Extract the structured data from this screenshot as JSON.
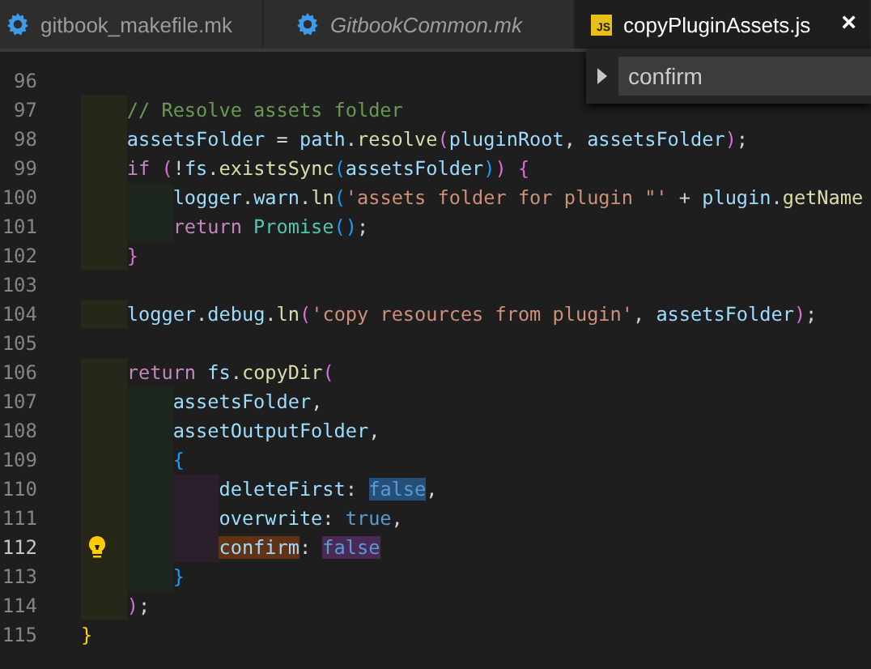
{
  "tabs": [
    {
      "label": "gitbook_makefile.mk",
      "kind": "makefile",
      "italic": false,
      "selected": false,
      "closable": false
    },
    {
      "label": "GitbookCommon.mk",
      "kind": "makefile",
      "italic": true,
      "selected": false,
      "closable": false
    },
    {
      "label": "copyPluginAssets.js",
      "kind": "script",
      "italic": false,
      "selected": true,
      "closable": true
    }
  ],
  "js_badge": "JS",
  "close_glyph": "×",
  "find_widget": {
    "value": "confirm"
  },
  "editor": {
    "lines": [
      {
        "number": "96",
        "current": false
      },
      {
        "number": "97",
        "current": false,
        "tokens": [
          {
            "text": "    // Resolve assets folder",
            "kind": "cmt"
          }
        ]
      },
      {
        "number": "98",
        "current": false,
        "tokens": [
          {
            "text": "    assetsFolder",
            "kind": "var"
          },
          {
            "text": " = ",
            "kind": "punct"
          },
          {
            "text": "path",
            "kind": "var"
          },
          {
            "text": ".",
            "kind": "punct"
          },
          {
            "text": "resolve",
            "kind": "fn"
          },
          {
            "text": "(",
            "kind": "b2"
          },
          {
            "text": "pluginRoot",
            "kind": "var"
          },
          {
            "text": ", ",
            "kind": "punct"
          },
          {
            "text": "assetsFolder",
            "kind": "var"
          },
          {
            "text": ")",
            "kind": "b2"
          },
          {
            "text": ";",
            "kind": "punct"
          }
        ]
      },
      {
        "number": "99",
        "current": false,
        "tokens": [
          {
            "text": "    if ",
            "kind": "kw"
          },
          {
            "text": "(",
            "kind": "b2"
          },
          {
            "text": "!",
            "kind": "punct"
          },
          {
            "text": "fs",
            "kind": "var"
          },
          {
            "text": ".",
            "kind": "punct"
          },
          {
            "text": "existsSync",
            "kind": "fn"
          },
          {
            "text": "(",
            "kind": "b3"
          },
          {
            "text": "assetsFolder",
            "kind": "var"
          },
          {
            "text": ")",
            "kind": "b3"
          },
          {
            "text": ")",
            "kind": "b2"
          },
          {
            "text": " {",
            "kind": "b2"
          }
        ]
      },
      {
        "number": "100",
        "current": false,
        "tokens": [
          {
            "text": "        logger",
            "kind": "var"
          },
          {
            "text": ".",
            "kind": "punct"
          },
          {
            "text": "warn",
            "kind": "var"
          },
          {
            "text": ".",
            "kind": "punct"
          },
          {
            "text": "ln",
            "kind": "fn"
          },
          {
            "text": "(",
            "kind": "b3"
          },
          {
            "text": "'assets folder for plugin \"'",
            "kind": "str"
          },
          {
            "text": " + ",
            "kind": "punct"
          },
          {
            "text": "plugin",
            "kind": "var"
          },
          {
            "text": ".",
            "kind": "punct"
          },
          {
            "text": "getName",
            "kind": "fn"
          }
        ]
      },
      {
        "number": "101",
        "current": false,
        "tokens": [
          {
            "text": "        return ",
            "kind": "kw"
          },
          {
            "text": "Promise",
            "kind": "cls"
          },
          {
            "text": "()",
            "kind": "b3"
          },
          {
            "text": ";",
            "kind": "punct"
          }
        ]
      },
      {
        "number": "102",
        "current": false,
        "tokens": [
          {
            "text": "    }",
            "kind": "b2"
          }
        ]
      },
      {
        "number": "103",
        "current": false
      },
      {
        "number": "104",
        "current": false,
        "tokens": [
          {
            "text": "    logger",
            "kind": "var"
          },
          {
            "text": ".",
            "kind": "punct"
          },
          {
            "text": "debug",
            "kind": "var"
          },
          {
            "text": ".",
            "kind": "punct"
          },
          {
            "text": "ln",
            "kind": "fn"
          },
          {
            "text": "(",
            "kind": "b2"
          },
          {
            "text": "'copy resources from plugin'",
            "kind": "str"
          },
          {
            "text": ", ",
            "kind": "punct"
          },
          {
            "text": "assetsFolder",
            "kind": "var"
          },
          {
            "text": ")",
            "kind": "b2"
          },
          {
            "text": ";",
            "kind": "punct"
          }
        ]
      },
      {
        "number": "105",
        "current": false
      },
      {
        "number": "106",
        "current": false,
        "tokens": [
          {
            "text": "    return ",
            "kind": "kw"
          },
          {
            "text": "fs",
            "kind": "var"
          },
          {
            "text": ".",
            "kind": "punct"
          },
          {
            "text": "copyDir",
            "kind": "fn"
          },
          {
            "text": "(",
            "kind": "b2"
          }
        ]
      },
      {
        "number": "107",
        "current": false,
        "tokens": [
          {
            "text": "        assetsFolder",
            "kind": "var"
          },
          {
            "text": ",",
            "kind": "punct"
          }
        ]
      },
      {
        "number": "108",
        "current": false,
        "tokens": [
          {
            "text": "        assetOutputFolder",
            "kind": "var"
          },
          {
            "text": ",",
            "kind": "punct"
          }
        ]
      },
      {
        "number": "109",
        "current": false,
        "tokens": [
          {
            "text": "        {",
            "kind": "b3"
          }
        ]
      },
      {
        "number": "110",
        "current": false,
        "tokens": [
          {
            "text": "            deleteFirst",
            "kind": "var"
          },
          {
            "text": ": ",
            "kind": "punct"
          },
          {
            "text": "false",
            "kind": "bool",
            "selected": true
          },
          {
            "text": ",",
            "kind": "punct"
          }
        ]
      },
      {
        "number": "111",
        "current": false,
        "tokens": [
          {
            "text": "            overwrite",
            "kind": "var"
          },
          {
            "text": ": ",
            "kind": "punct"
          },
          {
            "text": "true",
            "kind": "bool"
          },
          {
            "text": ",",
            "kind": "punct"
          }
        ]
      },
      {
        "number": "112",
        "current": true,
        "tokens": [
          {
            "text": "            confirm",
            "kind": "var",
            "find_match": true
          },
          {
            "text": ": ",
            "kind": "punct"
          },
          {
            "text": "false",
            "kind": "bool",
            "occurrence": true
          }
        ]
      },
      {
        "number": "113",
        "current": false,
        "tokens": [
          {
            "text": "        }",
            "kind": "b3"
          }
        ]
      },
      {
        "number": "114",
        "current": false,
        "tokens": [
          {
            "text": "    )",
            "kind": "b2"
          },
          {
            "text": ";",
            "kind": "punct"
          }
        ]
      },
      {
        "number": "115",
        "current": false,
        "tokens": [
          {
            "text": "}",
            "kind": "b1"
          }
        ]
      }
    ]
  }
}
